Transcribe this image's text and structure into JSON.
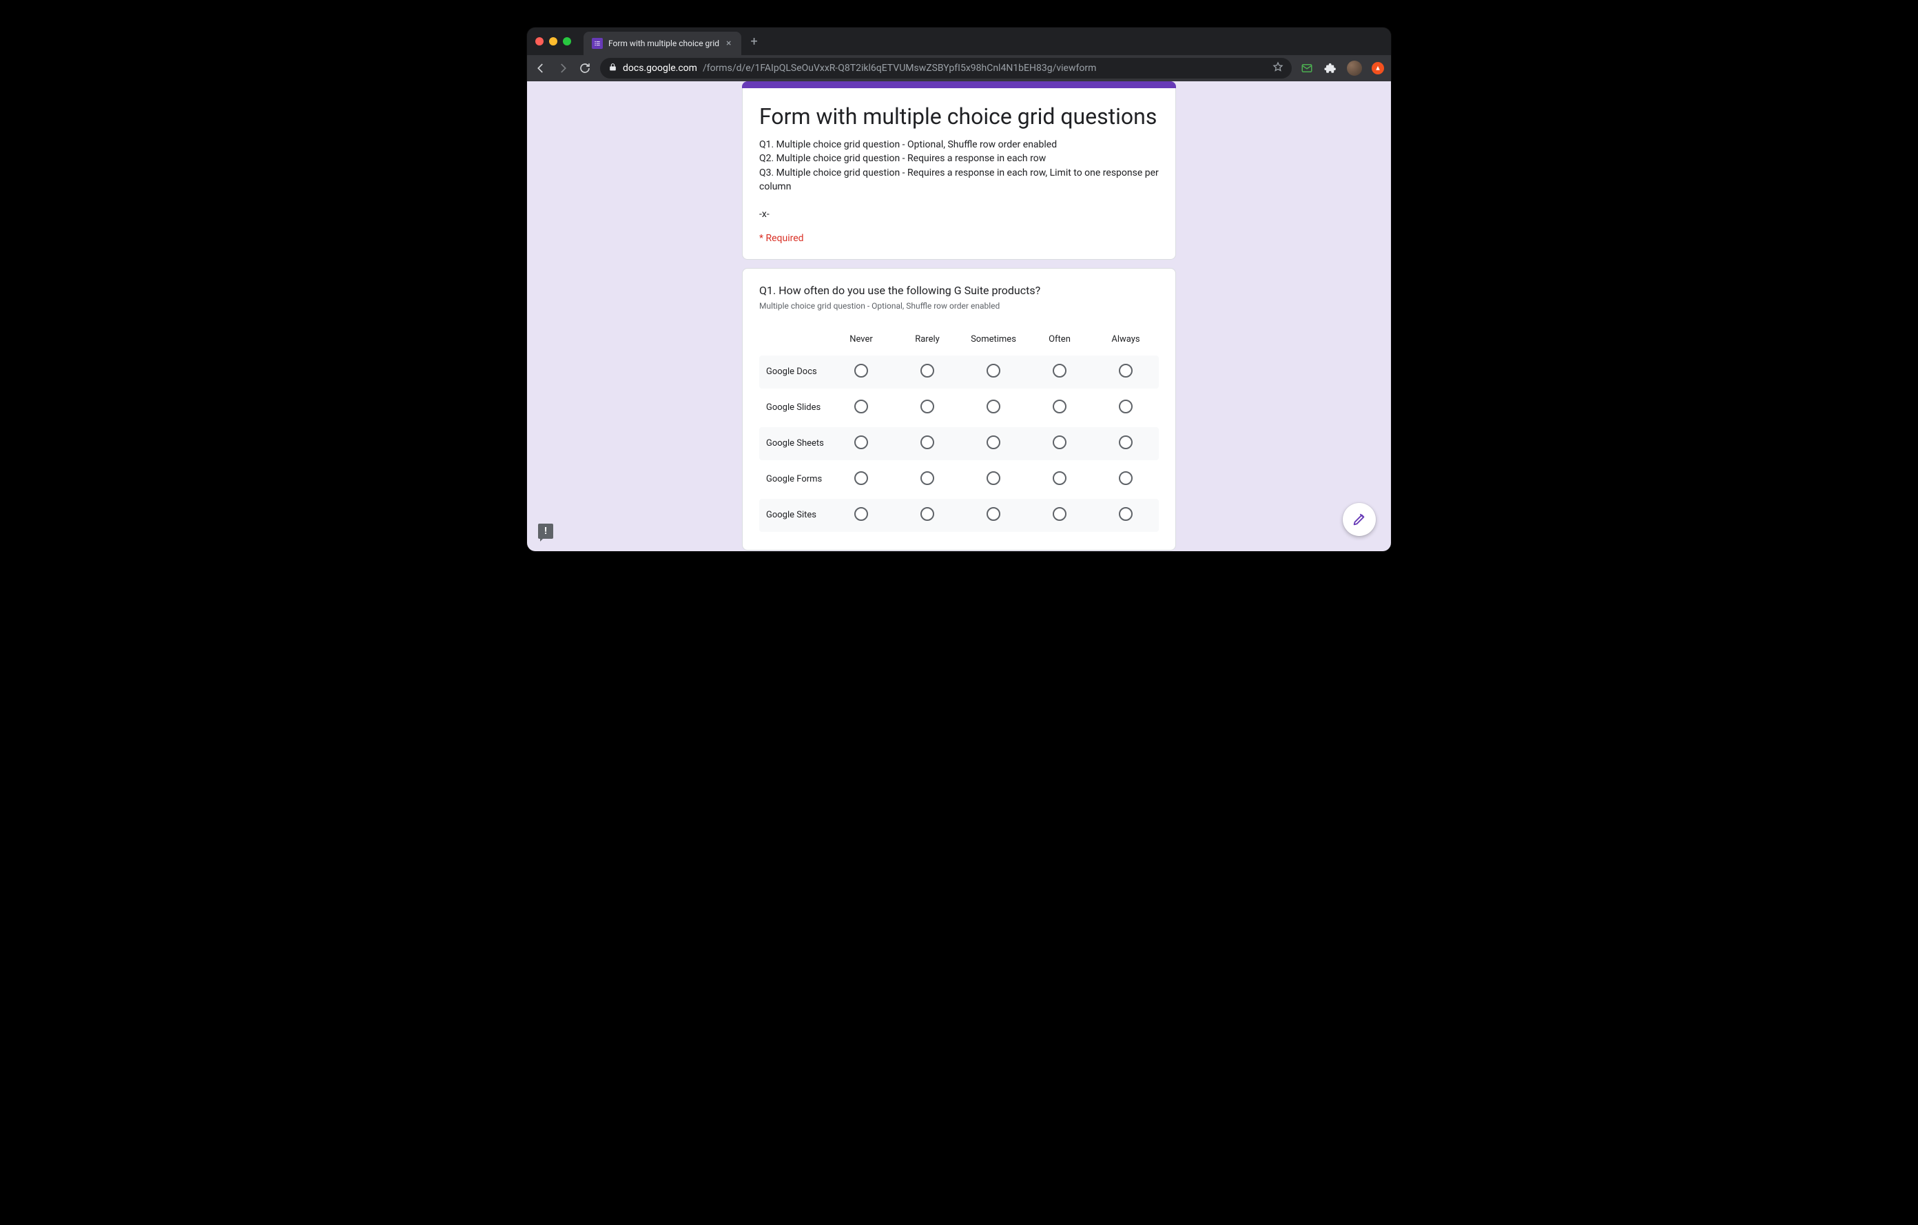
{
  "browser": {
    "tab_title": "Form with multiple choice grid",
    "url_host": "docs.google.com",
    "url_path": "/forms/d/e/1FAIpQLSeOuVxxR-Q8T2ikl6qETVUMswZSBYpfI5x98hCnl4N1bEH83g/viewform"
  },
  "form": {
    "accent_color": "#673ab7",
    "title": "Form with multiple choice grid questions",
    "description": "Q1. Multiple choice grid question - Optional, Shuffle row order enabled\nQ2. Multiple choice grid question - Requires a response in each row\nQ3. Multiple choice grid question - Requires a response in each row, Limit to one response per column\n\n-x-",
    "required_label": "* Required"
  },
  "question1": {
    "title": "Q1. How often do you use the following G Suite products?",
    "subtitle": "Multiple choice grid question - Optional, Shuffle row order enabled",
    "columns": [
      "Never",
      "Rarely",
      "Sometimes",
      "Often",
      "Always"
    ],
    "rows": [
      "Google Docs",
      "Google Slides",
      "Google Sheets",
      "Google Forms",
      "Google Sites"
    ]
  }
}
